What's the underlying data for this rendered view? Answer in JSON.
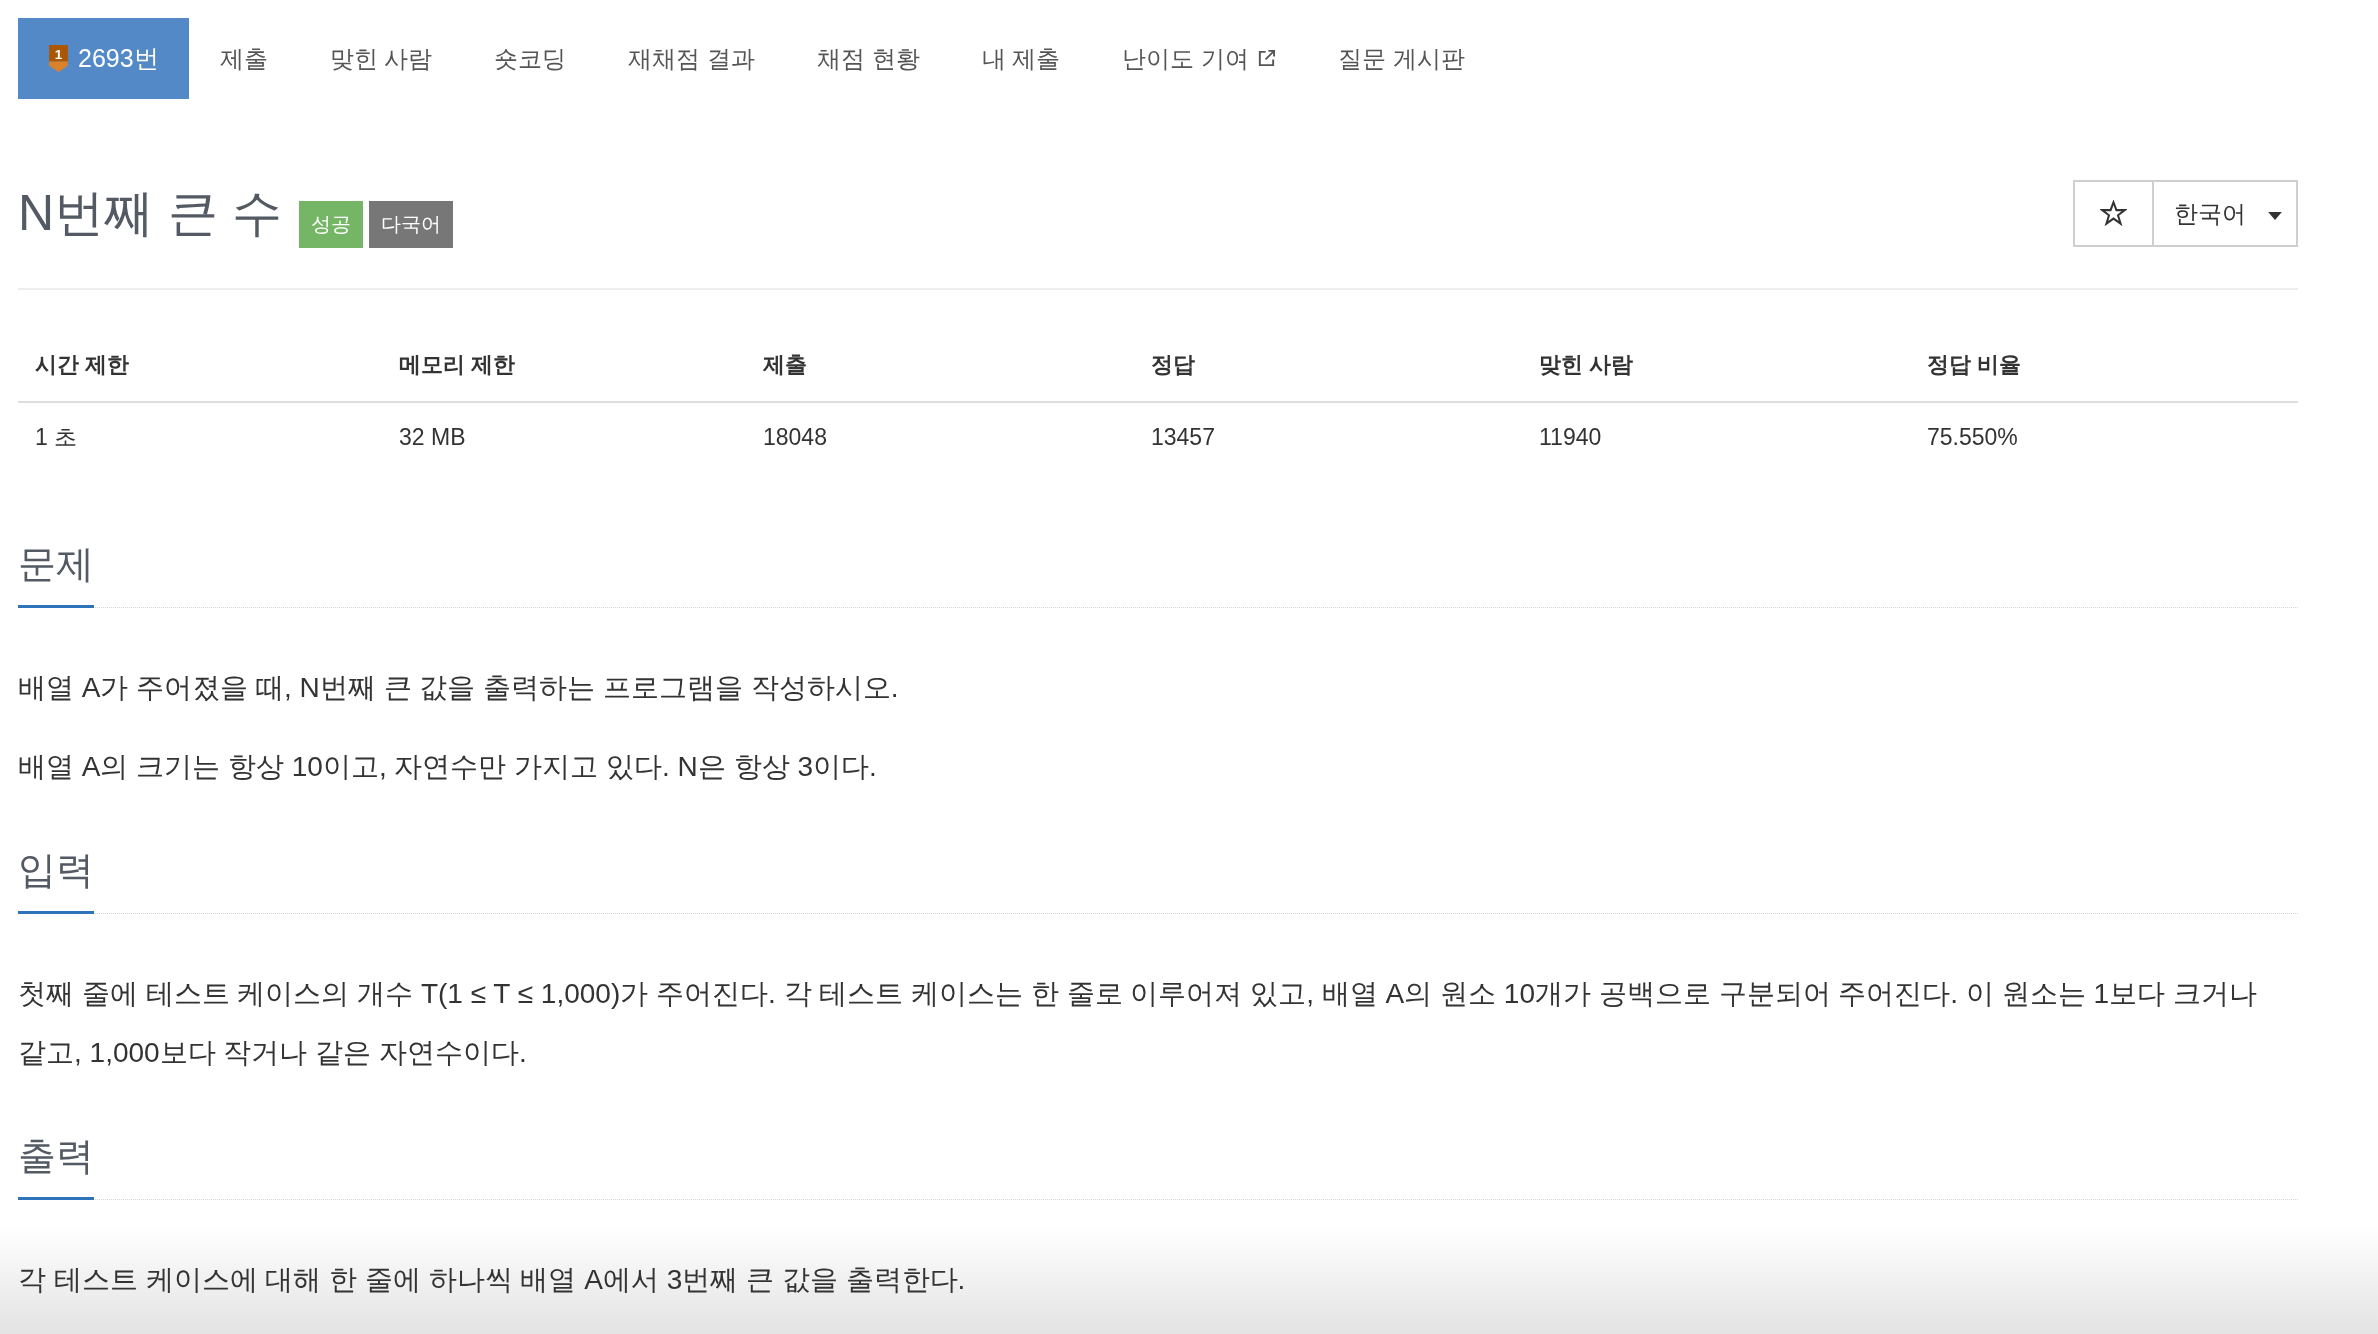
{
  "nav": {
    "tabs": [
      {
        "label": "2693번",
        "selected": true,
        "tier": "1"
      },
      {
        "label": "제출",
        "selected": false
      },
      {
        "label": "맞힌 사람",
        "selected": false
      },
      {
        "label": "숏코딩",
        "selected": false
      },
      {
        "label": "재채점 결과",
        "selected": false
      },
      {
        "label": "채점 현황",
        "selected": false
      },
      {
        "label": "내 제출",
        "selected": false
      },
      {
        "label": "난이도 기여",
        "selected": false,
        "external": true
      },
      {
        "label": "질문 게시판",
        "selected": false
      }
    ]
  },
  "problem": {
    "title": "N번째 큰 수",
    "badges": [
      {
        "label": "성공",
        "kind": "success"
      },
      {
        "label": "다국어",
        "kind": "multilang"
      }
    ]
  },
  "toolbar": {
    "starred": false,
    "language": "한국어"
  },
  "info_table": {
    "columns": [
      "시간 제한",
      "메모리 제한",
      "제출",
      "정답",
      "맞힌 사람",
      "정답 비율"
    ],
    "rows": [
      [
        "1 초",
        "32 MB",
        "18048",
        "13457",
        "11940",
        "75.550%"
      ]
    ]
  },
  "sections": [
    {
      "heading": "문제",
      "paragraphs": [
        "배열 A가 주어졌을 때, N번째 큰 값을 출력하는 프로그램을 작성하시오.",
        "배열 A의 크기는 항상 10이고, 자연수만 가지고 있다. N은 항상 3이다."
      ]
    },
    {
      "heading": "입력",
      "paragraphs": [
        "첫째 줄에 테스트 케이스의 개수 T(1 ≤ T ≤ 1,000)가 주어진다. 각 테스트 케이스는 한 줄로 이루어져 있고, 배열 A의 원소 10개가 공백으로 구분되어 주어진다. 이 원소는 1보다 크거나 같고, 1,000보다 작거나 같은 자연수이다."
      ]
    },
    {
      "heading": "출력",
      "paragraphs": [
        "각 테스트 케이스에 대해 한 줄에 하나씩 배열 A에서 3번째 큰 값을 출력한다."
      ]
    }
  ]
}
